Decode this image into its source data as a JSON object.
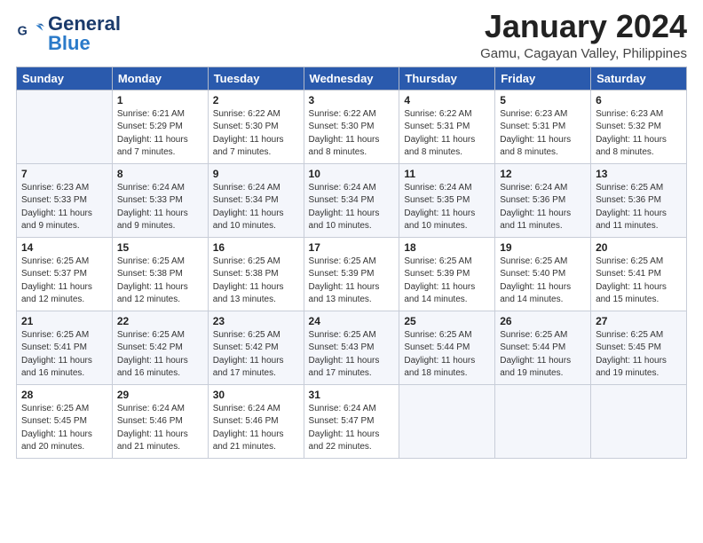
{
  "logo": {
    "text_general": "General",
    "text_blue": "Blue"
  },
  "header": {
    "title": "January 2024",
    "subtitle": "Gamu, Cagayan Valley, Philippines"
  },
  "weekdays": [
    "Sunday",
    "Monday",
    "Tuesday",
    "Wednesday",
    "Thursday",
    "Friday",
    "Saturday"
  ],
  "weeks": [
    [
      {
        "day": "",
        "sunrise": "",
        "sunset": "",
        "daylight": ""
      },
      {
        "day": "1",
        "sunrise": "Sunrise: 6:21 AM",
        "sunset": "Sunset: 5:29 PM",
        "daylight": "Daylight: 11 hours and 7 minutes."
      },
      {
        "day": "2",
        "sunrise": "Sunrise: 6:22 AM",
        "sunset": "Sunset: 5:30 PM",
        "daylight": "Daylight: 11 hours and 7 minutes."
      },
      {
        "day": "3",
        "sunrise": "Sunrise: 6:22 AM",
        "sunset": "Sunset: 5:30 PM",
        "daylight": "Daylight: 11 hours and 8 minutes."
      },
      {
        "day": "4",
        "sunrise": "Sunrise: 6:22 AM",
        "sunset": "Sunset: 5:31 PM",
        "daylight": "Daylight: 11 hours and 8 minutes."
      },
      {
        "day": "5",
        "sunrise": "Sunrise: 6:23 AM",
        "sunset": "Sunset: 5:31 PM",
        "daylight": "Daylight: 11 hours and 8 minutes."
      },
      {
        "day": "6",
        "sunrise": "Sunrise: 6:23 AM",
        "sunset": "Sunset: 5:32 PM",
        "daylight": "Daylight: 11 hours and 8 minutes."
      }
    ],
    [
      {
        "day": "7",
        "sunrise": "Sunrise: 6:23 AM",
        "sunset": "Sunset: 5:33 PM",
        "daylight": "Daylight: 11 hours and 9 minutes."
      },
      {
        "day": "8",
        "sunrise": "Sunrise: 6:24 AM",
        "sunset": "Sunset: 5:33 PM",
        "daylight": "Daylight: 11 hours and 9 minutes."
      },
      {
        "day": "9",
        "sunrise": "Sunrise: 6:24 AM",
        "sunset": "Sunset: 5:34 PM",
        "daylight": "Daylight: 11 hours and 10 minutes."
      },
      {
        "day": "10",
        "sunrise": "Sunrise: 6:24 AM",
        "sunset": "Sunset: 5:34 PM",
        "daylight": "Daylight: 11 hours and 10 minutes."
      },
      {
        "day": "11",
        "sunrise": "Sunrise: 6:24 AM",
        "sunset": "Sunset: 5:35 PM",
        "daylight": "Daylight: 11 hours and 10 minutes."
      },
      {
        "day": "12",
        "sunrise": "Sunrise: 6:24 AM",
        "sunset": "Sunset: 5:36 PM",
        "daylight": "Daylight: 11 hours and 11 minutes."
      },
      {
        "day": "13",
        "sunrise": "Sunrise: 6:25 AM",
        "sunset": "Sunset: 5:36 PM",
        "daylight": "Daylight: 11 hours and 11 minutes."
      }
    ],
    [
      {
        "day": "14",
        "sunrise": "Sunrise: 6:25 AM",
        "sunset": "Sunset: 5:37 PM",
        "daylight": "Daylight: 11 hours and 12 minutes."
      },
      {
        "day": "15",
        "sunrise": "Sunrise: 6:25 AM",
        "sunset": "Sunset: 5:38 PM",
        "daylight": "Daylight: 11 hours and 12 minutes."
      },
      {
        "day": "16",
        "sunrise": "Sunrise: 6:25 AM",
        "sunset": "Sunset: 5:38 PM",
        "daylight": "Daylight: 11 hours and 13 minutes."
      },
      {
        "day": "17",
        "sunrise": "Sunrise: 6:25 AM",
        "sunset": "Sunset: 5:39 PM",
        "daylight": "Daylight: 11 hours and 13 minutes."
      },
      {
        "day": "18",
        "sunrise": "Sunrise: 6:25 AM",
        "sunset": "Sunset: 5:39 PM",
        "daylight": "Daylight: 11 hours and 14 minutes."
      },
      {
        "day": "19",
        "sunrise": "Sunrise: 6:25 AM",
        "sunset": "Sunset: 5:40 PM",
        "daylight": "Daylight: 11 hours and 14 minutes."
      },
      {
        "day": "20",
        "sunrise": "Sunrise: 6:25 AM",
        "sunset": "Sunset: 5:41 PM",
        "daylight": "Daylight: 11 hours and 15 minutes."
      }
    ],
    [
      {
        "day": "21",
        "sunrise": "Sunrise: 6:25 AM",
        "sunset": "Sunset: 5:41 PM",
        "daylight": "Daylight: 11 hours and 16 minutes."
      },
      {
        "day": "22",
        "sunrise": "Sunrise: 6:25 AM",
        "sunset": "Sunset: 5:42 PM",
        "daylight": "Daylight: 11 hours and 16 minutes."
      },
      {
        "day": "23",
        "sunrise": "Sunrise: 6:25 AM",
        "sunset": "Sunset: 5:42 PM",
        "daylight": "Daylight: 11 hours and 17 minutes."
      },
      {
        "day": "24",
        "sunrise": "Sunrise: 6:25 AM",
        "sunset": "Sunset: 5:43 PM",
        "daylight": "Daylight: 11 hours and 17 minutes."
      },
      {
        "day": "25",
        "sunrise": "Sunrise: 6:25 AM",
        "sunset": "Sunset: 5:44 PM",
        "daylight": "Daylight: 11 hours and 18 minutes."
      },
      {
        "day": "26",
        "sunrise": "Sunrise: 6:25 AM",
        "sunset": "Sunset: 5:44 PM",
        "daylight": "Daylight: 11 hours and 19 minutes."
      },
      {
        "day": "27",
        "sunrise": "Sunrise: 6:25 AM",
        "sunset": "Sunset: 5:45 PM",
        "daylight": "Daylight: 11 hours and 19 minutes."
      }
    ],
    [
      {
        "day": "28",
        "sunrise": "Sunrise: 6:25 AM",
        "sunset": "Sunset: 5:45 PM",
        "daylight": "Daylight: 11 hours and 20 minutes."
      },
      {
        "day": "29",
        "sunrise": "Sunrise: 6:24 AM",
        "sunset": "Sunset: 5:46 PM",
        "daylight": "Daylight: 11 hours and 21 minutes."
      },
      {
        "day": "30",
        "sunrise": "Sunrise: 6:24 AM",
        "sunset": "Sunset: 5:46 PM",
        "daylight": "Daylight: 11 hours and 21 minutes."
      },
      {
        "day": "31",
        "sunrise": "Sunrise: 6:24 AM",
        "sunset": "Sunset: 5:47 PM",
        "daylight": "Daylight: 11 hours and 22 minutes."
      },
      {
        "day": "",
        "sunrise": "",
        "sunset": "",
        "daylight": ""
      },
      {
        "day": "",
        "sunrise": "",
        "sunset": "",
        "daylight": ""
      },
      {
        "day": "",
        "sunrise": "",
        "sunset": "",
        "daylight": ""
      }
    ]
  ]
}
